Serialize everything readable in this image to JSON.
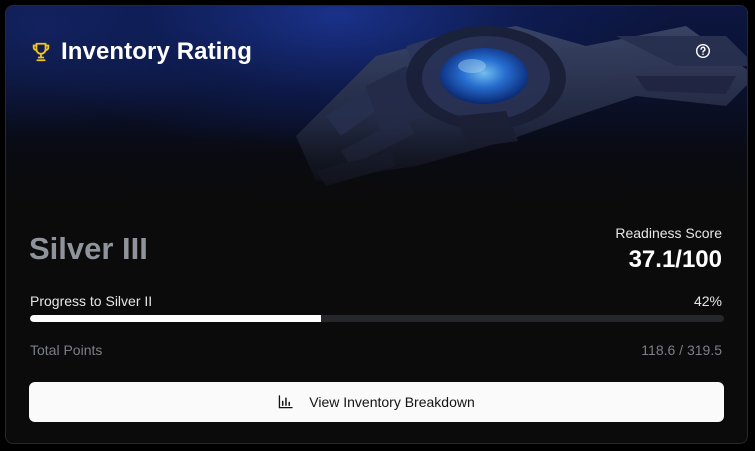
{
  "header": {
    "title": "Inventory Rating",
    "icon": "trophy-icon",
    "help_icon": "help-circle-icon"
  },
  "rank": {
    "current": "Silver III"
  },
  "readiness": {
    "label": "Readiness Score",
    "value": "37.1/100"
  },
  "progress": {
    "label": "Progress to Silver II",
    "percent_text": "42%",
    "fraction": 0.42
  },
  "points": {
    "label": "Total Points",
    "value": "118.6 / 319.5"
  },
  "action": {
    "label": "View Inventory Breakdown",
    "icon": "bar-chart-icon"
  },
  "colors": {
    "accent_gold": "#f5c518",
    "hero_blue": "#1c3696",
    "rank_gray": "#8f939b",
    "progress_fill": "#ffffff",
    "progress_track": "#26272b"
  }
}
